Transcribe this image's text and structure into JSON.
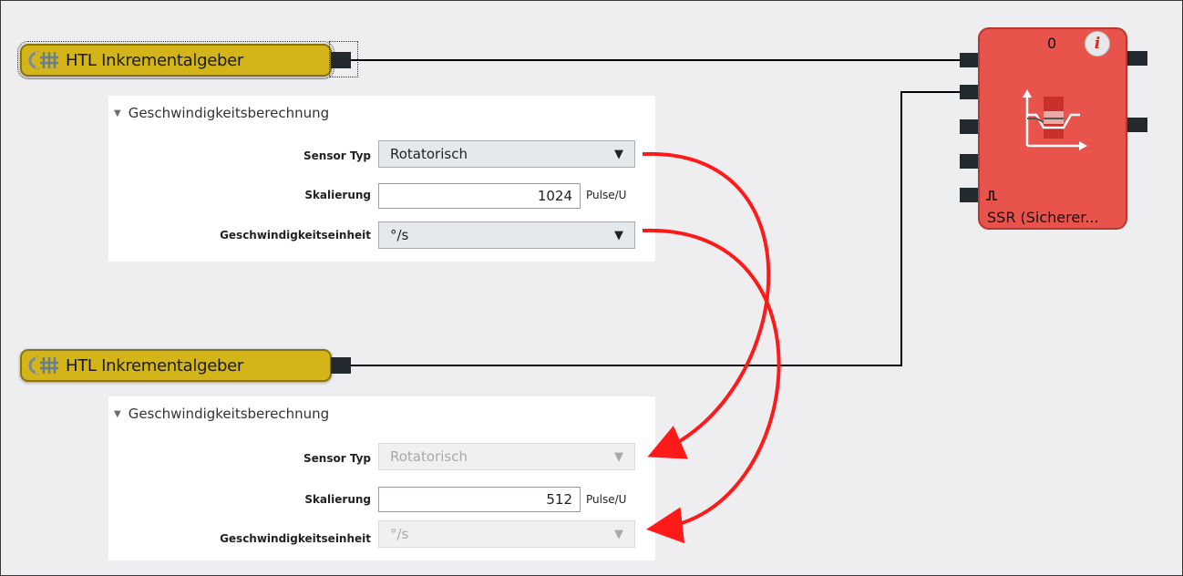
{
  "colors": {
    "canvas_bg": "#eeeef0",
    "encoder_fill": "#d3b51a",
    "ssr_fill": "#e8534c",
    "annotation_arrow": "#ff1a1a",
    "wire": "#000000"
  },
  "encoders": [
    {
      "label": "HTL Inkrementalgeber",
      "icon": "encoder-icon",
      "selected": true,
      "section_title": "Geschwindigkeitsberechnung",
      "sensor_type_label": "Sensor Typ",
      "sensor_type_value": "Rotatorisch",
      "scaling_label": "Skalierung",
      "scaling_value": "1024",
      "scaling_unit": "Pulse/U",
      "speed_unit_label": "Geschwindigkeitseinheit",
      "speed_unit_value": "°/s",
      "fields_enabled": true
    },
    {
      "label": "HTL Inkrementalgeber",
      "icon": "encoder-icon",
      "selected": false,
      "section_title": "Geschwindigkeitsberechnung",
      "sensor_type_label": "Sensor Typ",
      "sensor_type_value": "Rotatorisch",
      "scaling_label": "Skalierung",
      "scaling_value": "512",
      "scaling_unit": "Pulse/U",
      "speed_unit_label": "Geschwindigkeitseinheit",
      "speed_unit_value": "°/s",
      "fields_enabled": false
    }
  ],
  "ssr_block": {
    "count": "0",
    "label": "SSR (Sicherer...",
    "info_icon": "info-icon",
    "graph_icon": "speed-range-graph-icon",
    "edge_icon": "edge-trigger-icon"
  }
}
